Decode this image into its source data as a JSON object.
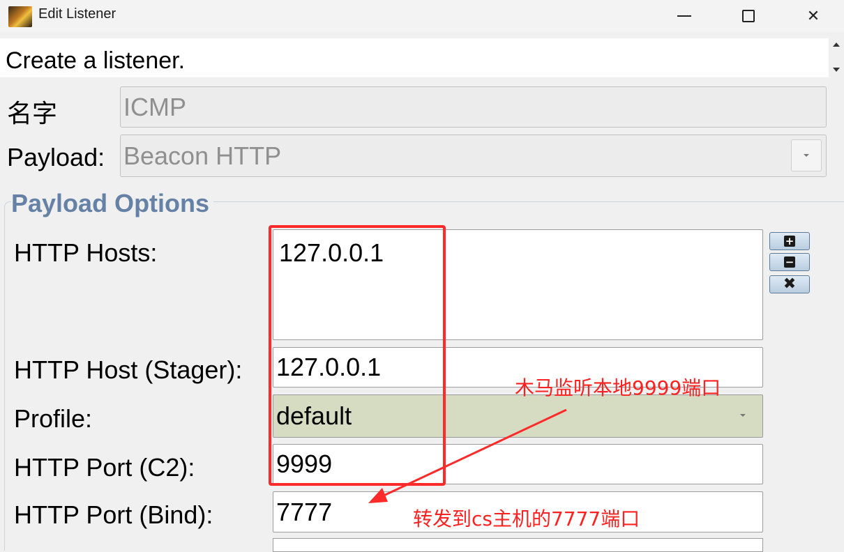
{
  "window": {
    "title": "Edit Listener",
    "minimize_glyph": "",
    "close_glyph": "✕"
  },
  "header": {
    "text": "Create a listener."
  },
  "form": {
    "name_label": "名字",
    "name_value": "ICMP",
    "payload_label": "Payload:",
    "payload_value": "Beacon HTTP"
  },
  "payload_options": {
    "group_title": "Payload Options",
    "http_hosts_label": "HTTP Hosts:",
    "http_hosts_value": "127.0.0.1",
    "stager_label": "HTTP Host (Stager):",
    "stager_value": "127.0.0.1",
    "profile_label": "Profile:",
    "profile_value": "default",
    "port_c2_label": "HTTP Port (C2):",
    "port_c2_value": "9999",
    "port_bind_label": "HTTP Port (Bind):",
    "port_bind_value": "7777",
    "hosts_buttons": [
      {
        "icon": "plus-icon",
        "glyph": "+"
      },
      {
        "icon": "minus-icon",
        "glyph": "−"
      },
      {
        "icon": "remove-icon",
        "glyph": "✖"
      }
    ]
  },
  "annotations": {
    "note1": "木马监听本地9999端口",
    "note2": "转发到cs主机的7777端口",
    "color": "#ff2020"
  },
  "colors": {
    "group_title": "#6582a6",
    "profile_bg": "#d6dcc2",
    "highlight_red": "#ff2a2a"
  }
}
